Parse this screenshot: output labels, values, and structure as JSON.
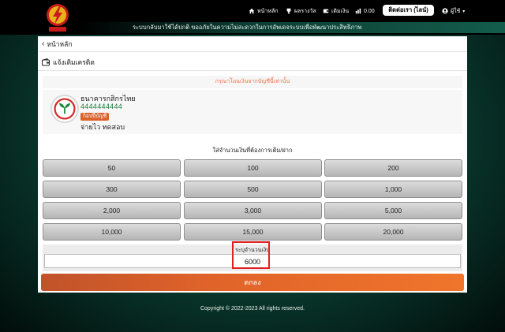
{
  "header": {
    "marquee": "ระบบกลับมาใช้ได้ปกติ ขออภัยในความไม่สะดวกในการอัพเดจระบบเพื่อพัฒนาประสิทธิภาพ",
    "nav": [
      {
        "label": "หน้าหลัก",
        "icon": "home-icon"
      },
      {
        "label": "ผลรางวัล",
        "icon": "trophy-icon"
      },
      {
        "label": "เติมเงิน",
        "icon": "wallet-icon"
      },
      {
        "label": "0.00",
        "icon": "chart-bars-icon"
      }
    ],
    "contact_label": "ติดต่อเรา (ไลน์)",
    "user_label": "ผู้ใช้"
  },
  "page": {
    "back_label": "หน้าหลัก",
    "section_title": "แจ้งเติมเครดิต",
    "warning": "กรุณาโอนเงินจากบัญชีนี้เท่านั้น"
  },
  "bank": {
    "name": "ธนาคารกสิกรไทย",
    "account_number": "4444444444",
    "copy_label": "ก็อปปี้บัญชี",
    "holder": "จ่ายไว ทดสอบ"
  },
  "amount": {
    "prompt": "ใส่จำนวนเงินที่ต้องการเติม/ฝาก",
    "options": [
      "50",
      "100",
      "200",
      "300",
      "500",
      "1,000",
      "2,000",
      "3,000",
      "5,000",
      "10,000",
      "15,000",
      "20,000"
    ],
    "custom_label": "ระบุจำนวนเงิน",
    "custom_value": "6000",
    "submit_label": "ตกลง"
  },
  "footer": {
    "copyright": "Copyright © 2022-2023 All rights reserved."
  },
  "colors": {
    "accent": "#e0632a",
    "bank_green": "#1a7a3b",
    "warning": "#e8714a",
    "highlight": "#e02020"
  }
}
